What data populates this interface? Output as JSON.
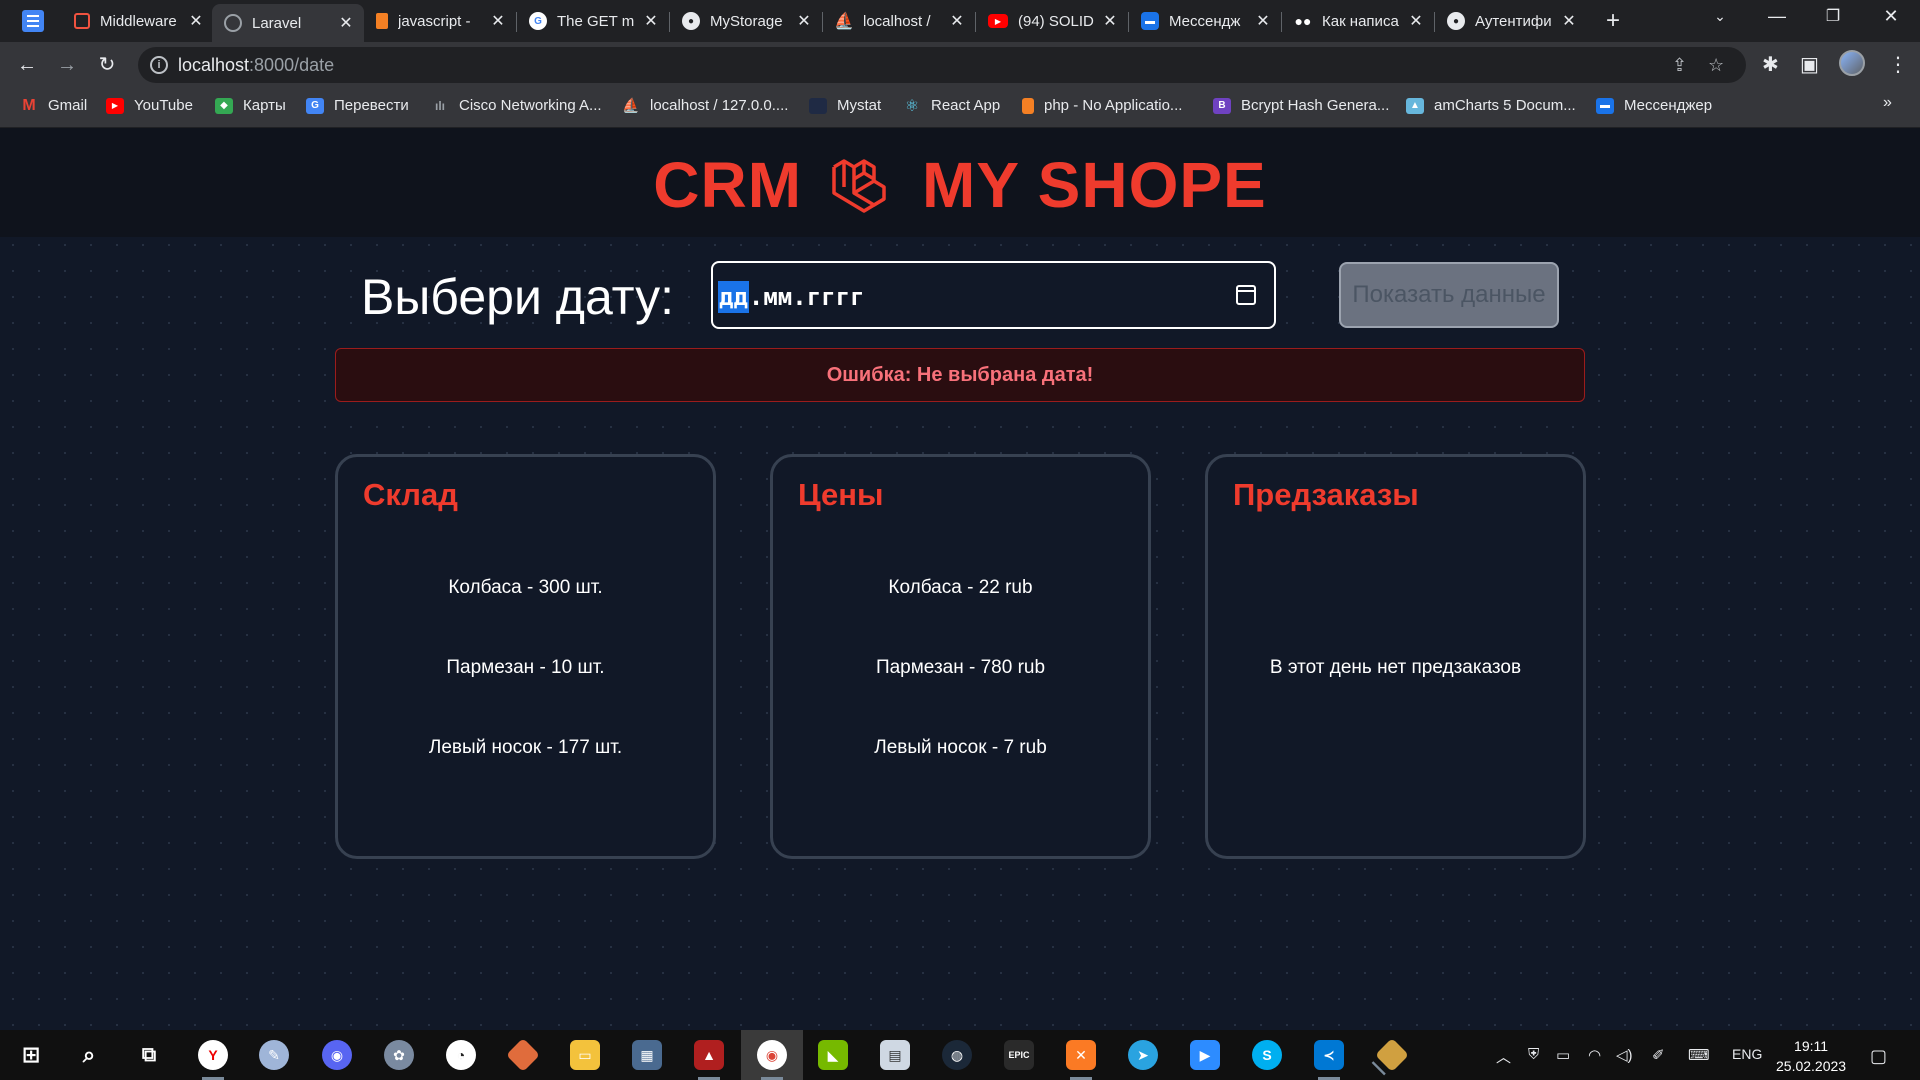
{
  "browser": {
    "tabs": [
      {
        "title": "Middleware",
        "icon": "laravel-icon",
        "color": "#f05340"
      },
      {
        "title": "Laravel",
        "icon": "globe-icon",
        "color": "#9aa0a6",
        "active": true
      },
      {
        "title": "javascript -",
        "icon": "stackoverflow-icon",
        "color": "#f48024"
      },
      {
        "title": "The GET m",
        "icon": "google-icon",
        "color": "#4285f4"
      },
      {
        "title": "MyStorage",
        "icon": "github-icon",
        "color": "#e8eaed"
      },
      {
        "title": "localhost /",
        "icon": "phpmyadmin-icon",
        "color": "#f29111"
      },
      {
        "title": "(94) SOLID",
        "icon": "youtube-icon",
        "color": "#ff0000"
      },
      {
        "title": "Мессендж",
        "icon": "messenger-icon",
        "color": "#1a73e8"
      },
      {
        "title": "Как написа",
        "icon": "medium-icon",
        "color": "#ffffff"
      },
      {
        "title": "Аутентифи",
        "icon": "github-icon",
        "color": "#e8eaed"
      }
    ],
    "url_host": "localhost",
    "url_path": ":8000/date",
    "bookmarks": [
      {
        "label": "Gmail",
        "icon": "gmail-icon",
        "color": "#ea4335"
      },
      {
        "label": "YouTube",
        "icon": "youtube-icon",
        "color": "#ff0000"
      },
      {
        "label": "Карты",
        "icon": "maps-icon",
        "color": "#34a853"
      },
      {
        "label": "Перевести",
        "icon": "translate-icon",
        "color": "#4285f4"
      },
      {
        "label": "Cisco Networking A...",
        "icon": "cisco-icon",
        "color": "#5f6368"
      },
      {
        "label": "localhost / 127.0.0....",
        "icon": "phpmyadmin-icon",
        "color": "#f29111"
      },
      {
        "label": "Mystat",
        "icon": "mystat-icon",
        "color": "#1f2a44"
      },
      {
        "label": "React App",
        "icon": "react-icon",
        "color": "#61dafb"
      },
      {
        "label": "php - No Applicatio...",
        "icon": "stackoverflow-icon",
        "color": "#f48024"
      },
      {
        "label": "Bcrypt Hash Genera...",
        "icon": "bcrypt-icon",
        "color": "#6f42c1"
      },
      {
        "label": "amCharts 5 Docum...",
        "icon": "amcharts-icon",
        "color": "#67b7dc"
      },
      {
        "label": "Мессенджер",
        "icon": "messenger-icon",
        "color": "#1a73e8"
      }
    ]
  },
  "app": {
    "brand_left": "CRM",
    "brand_right": "MY SHOPE",
    "date_label": "Выбери дату:",
    "date_placeholder_day": "дд",
    "date_placeholder_rest": ".мм.гггг",
    "show_button": "Показать данные",
    "error": "Ошибка: Не выбрана дата!",
    "cards": {
      "stock": {
        "title": "Склад",
        "items": [
          "Колбаса - 300 шт.",
          "Пармезан - 10 шт.",
          "Левый носок - 177 шт."
        ]
      },
      "prices": {
        "title": "Цены",
        "items": [
          "Колбаса - 22 rub",
          "Пармезан - 780 rub",
          "Левый носок - 7 rub"
        ]
      },
      "preorders": {
        "title": "Предзаказы",
        "empty": "В этот день нет предзаказов"
      }
    },
    "accent_color": "#ef3b2d"
  },
  "taskbar": {
    "lang": "ENG",
    "time": "19:11",
    "date": "25.02.2023"
  }
}
